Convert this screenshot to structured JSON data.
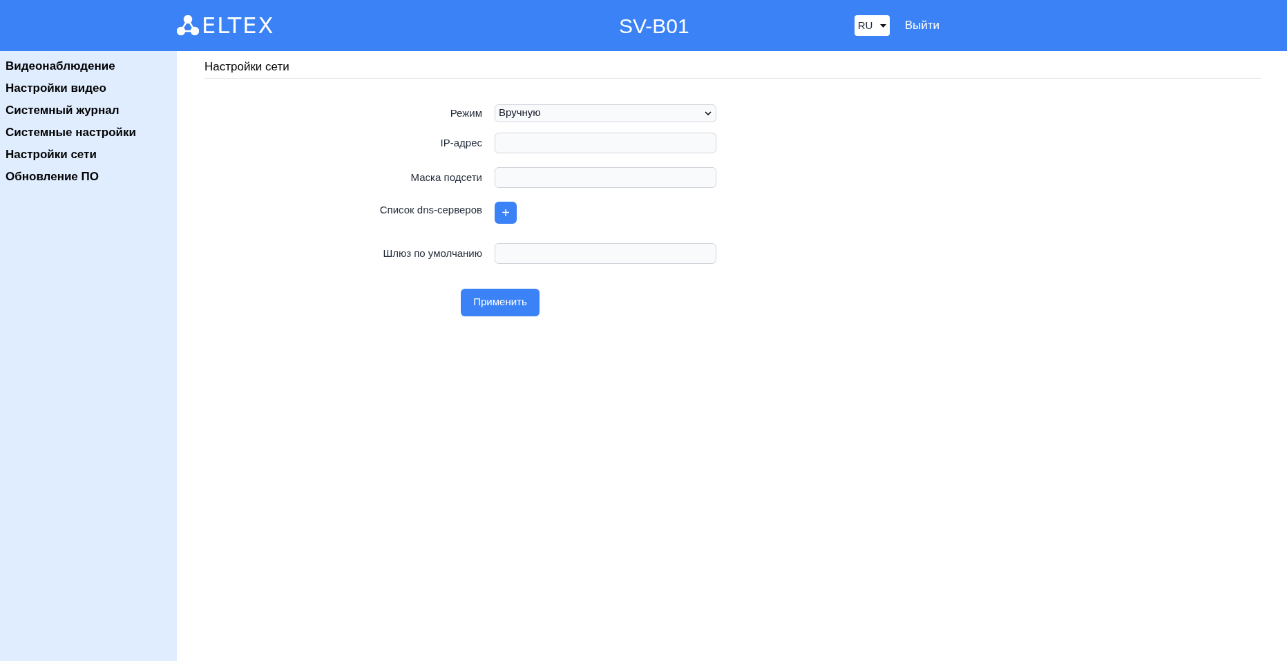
{
  "header": {
    "logo": "ELTEX",
    "title": "SV-B01",
    "language": "RU",
    "logout": "Выйти"
  },
  "sidebar": {
    "items": [
      {
        "label": "Видеонаблюдение"
      },
      {
        "label": "Настройки видео"
      },
      {
        "label": "Системный журнал"
      },
      {
        "label": "Системные настройки"
      },
      {
        "label": "Настройки сети"
      },
      {
        "label": "Обновление ПО"
      }
    ]
  },
  "page": {
    "title": "Настройки сети",
    "fields": [
      {
        "kind": "select",
        "label": "Режим",
        "value": "Вручную"
      },
      {
        "kind": "input",
        "label": "IP-адрес"
      },
      {
        "kind": "input",
        "label": "Маска подсети"
      },
      {
        "kind": "add",
        "label": "Список dns-серверов",
        "button": "+"
      },
      {
        "kind": "input",
        "label": "Шлюз по умолчанию"
      }
    ],
    "apply_button": "Применить"
  }
}
